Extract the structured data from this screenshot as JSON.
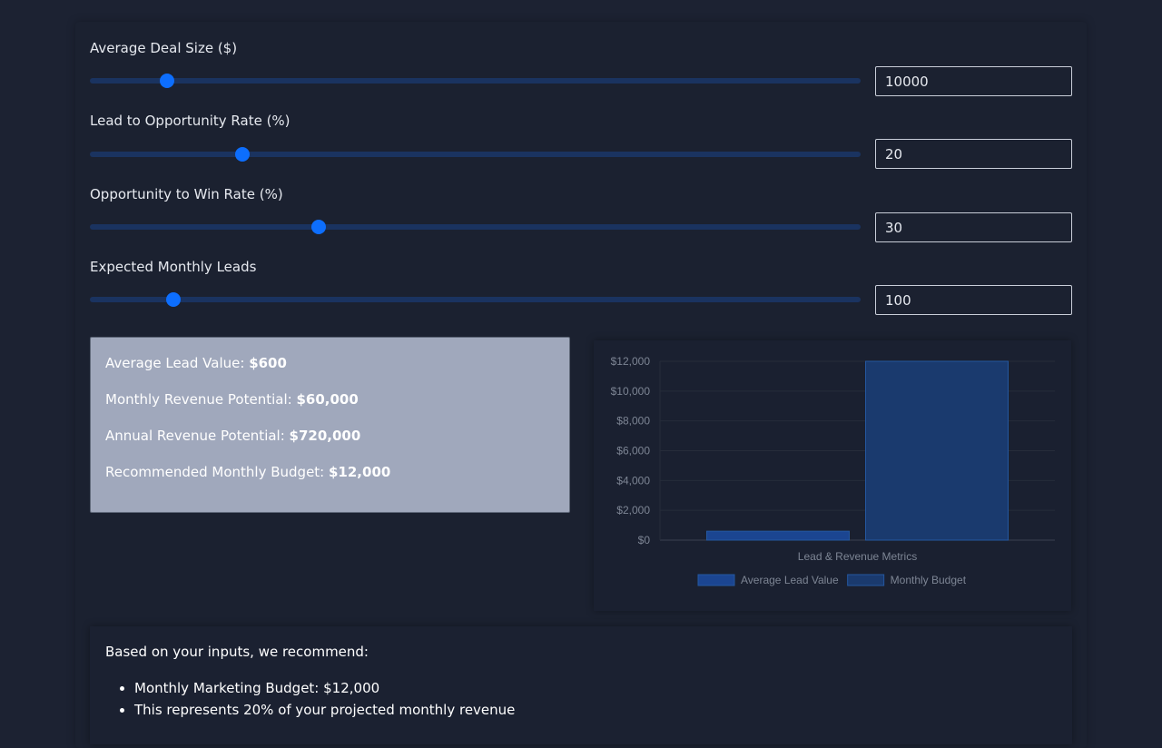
{
  "inputs": [
    {
      "label": "Average Deal Size ($)",
      "value": "10000",
      "slider_fraction": 0.1
    },
    {
      "label": "Lead to Opportunity Rate (%)",
      "value": "20",
      "slider_fraction": 0.198
    },
    {
      "label": "Opportunity to Win Rate (%)",
      "value": "30",
      "slider_fraction": 0.297
    },
    {
      "label": "Expected Monthly Leads",
      "value": "100",
      "slider_fraction": 0.108
    }
  ],
  "results": {
    "lead_value_label": "Average Lead Value: ",
    "lead_value": "$600",
    "monthly_revenue_label": "Monthly Revenue Potential: ",
    "monthly_revenue": "$60,000",
    "annual_revenue_label": "Annual Revenue Potential: ",
    "annual_revenue": "$720,000",
    "budget_label": "Recommended Monthly Budget: ",
    "budget": "$12,000"
  },
  "chart_data": {
    "type": "bar",
    "categories": [
      "Lead & Revenue Metrics"
    ],
    "series": [
      {
        "name": "Average Lead Value",
        "values": [
          600
        ],
        "color": "#1b4591"
      },
      {
        "name": "Monthly Budget",
        "values": [
          12000
        ],
        "color": "#1a3a6e"
      }
    ],
    "xlabel": "Lead & Revenue Metrics",
    "ylabel": "",
    "ylim": [
      0,
      12000
    ],
    "yticks": [
      "$0",
      "$2,000",
      "$4,000",
      "$6,000",
      "$8,000",
      "$10,000",
      "$12,000"
    ],
    "grid": true,
    "legend": "bottom"
  },
  "recommendation": {
    "intro": "Based on your inputs, we recommend:",
    "items": [
      "Monthly Marketing Budget: $12,000",
      "This represents 20% of your projected monthly revenue"
    ]
  }
}
